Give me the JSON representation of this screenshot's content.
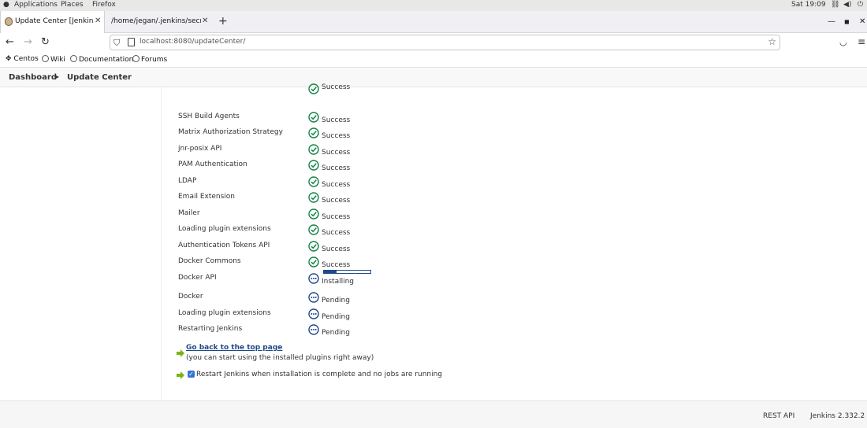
{
  "system_bar": {
    "menus": [
      "Applications",
      "Places",
      "Firefox"
    ],
    "clock": "Sat 19:09"
  },
  "browser": {
    "tabs": [
      {
        "label": "Update Center [Jenkins]",
        "active": true
      },
      {
        "label": "/home/jegan/.jenkins/secrets/",
        "active": false
      }
    ],
    "url": "localhost:8080/updateCenter/",
    "bookmarks": [
      "Centos",
      "Wiki",
      "Documentation",
      "Forums"
    ]
  },
  "breadcrumb": {
    "items": [
      "Dashboard",
      "Update Center"
    ]
  },
  "install_rows": [
    {
      "name": "",
      "status": "Success",
      "state": "success"
    },
    {
      "name": "SSH Build Agents",
      "status": "Success",
      "state": "success"
    },
    {
      "name": "Matrix Authorization Strategy",
      "status": "Success",
      "state": "success"
    },
    {
      "name": "jnr-posix API",
      "status": "Success",
      "state": "success"
    },
    {
      "name": "PAM Authentication",
      "status": "Success",
      "state": "success"
    },
    {
      "name": "LDAP",
      "status": "Success",
      "state": "success"
    },
    {
      "name": "Email Extension",
      "status": "Success",
      "state": "success"
    },
    {
      "name": "Mailer",
      "status": "Success",
      "state": "success"
    },
    {
      "name": "Loading plugin extensions",
      "status": "Success",
      "state": "success"
    },
    {
      "name": "Authentication Tokens API",
      "status": "Success",
      "state": "success"
    },
    {
      "name": "Docker Commons",
      "status": "Success",
      "state": "success"
    },
    {
      "name": "Docker API",
      "status": "Installing",
      "state": "installing",
      "progress": 0.27
    },
    {
      "name": "Docker",
      "status": "Pending",
      "state": "pending"
    },
    {
      "name": "Loading plugin extensions",
      "status": "Pending",
      "state": "pending"
    },
    {
      "name": "Restarting Jenkins",
      "status": "Pending",
      "state": "pending"
    }
  ],
  "actions": {
    "top_link": "Go back to the top page",
    "top_hint": "(you can start using the installed plugins right away)",
    "restart_checkbox_label": "Restart Jenkins when installation is complete and no jobs are running",
    "restart_checked": true
  },
  "footer": {
    "rest_api": "REST API",
    "version": "Jenkins 2.332.2"
  },
  "colors": {
    "success": "#138347",
    "pending": "#204a87",
    "link": "#204a87",
    "arrow": "#7ab317"
  }
}
